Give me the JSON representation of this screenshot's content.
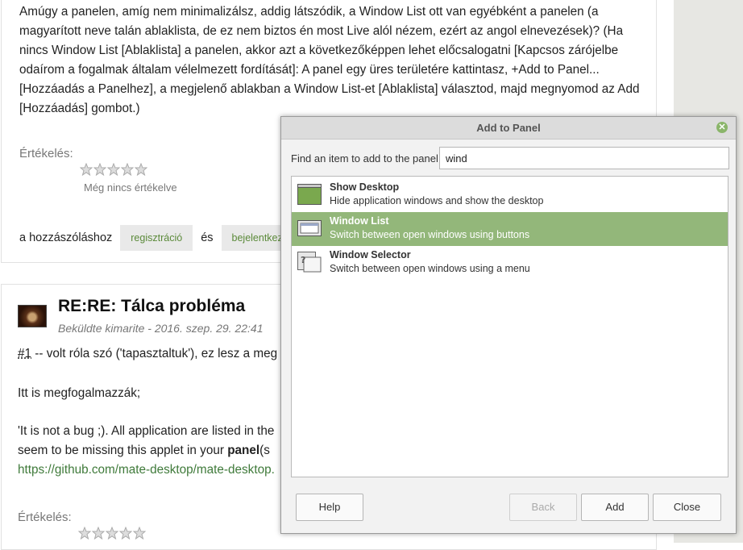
{
  "page": {
    "paragraph": "Amúgy a panelen, amíg nem minimalizálsz, addig látszódik, a Window List ott van egyébként a panelen (a magyarított neve talán ablaklista, de ez nem biztos én most Live alól nézem, ezért az angol elnevezések)? (Ha nincs Window List [Ablaklista] a panelen, akkor azt a következőképpen lehet előcsalogatni [Kapcsos zárójelbe odaírom a fogalmak általam vélelmezett fordítását]: A panel egy üres területére kattintasz, +Add to Panel... [Hozzáadás a Panelhez], a megjelenő ablakban a Window List-et [Ablaklista] választod, majd megnyomod az Add [Hozzáadás] gombot.)",
    "rating_label": "Értékelés:",
    "no_rating": "Még nincs értékelve",
    "comment_prefix": "a hozzászóláshoz",
    "register_link": "regisztráció",
    "and_word": "és",
    "login_link": "bejelentkezés",
    "post": {
      "title": "RE:RE: Tálca probléma",
      "meta": "Beküldte kimarite - 2016. szep. 29. 22:41",
      "line1_ref": "#1",
      "line1_rest": " -- volt róla szó ('tapasztaltuk'), ez lesz a meg",
      "line2": "Itt is megfogalmazzák;",
      "line3": "'It is not a bug ;). All application are listed in the",
      "line4_pre": "seem to be missing this applet in your ",
      "line4_bold": "panel",
      "line4_post": "(s",
      "link": "https://github.com/mate-desktop/mate-desktop.",
      "rating_label": "Értékelés:"
    }
  },
  "dialog": {
    "title": "Add to Panel",
    "find_label": "Find an item to add to the panel:",
    "search_value": "wind",
    "items": [
      {
        "name": "Show Desktop",
        "desc": "Hide application windows and show the desktop",
        "icon": "show-desktop-icon",
        "selected": false
      },
      {
        "name": "Window List",
        "desc": "Switch between open windows using buttons",
        "icon": "window-list-icon",
        "selected": true
      },
      {
        "name": "Window Selector",
        "desc": "Switch between open windows using a menu",
        "icon": "window-selector-icon",
        "selected": false
      }
    ],
    "buttons": {
      "help": "Help",
      "back": "Back",
      "add": "Add",
      "close": "Close"
    },
    "accent_color": "#93b77a"
  }
}
